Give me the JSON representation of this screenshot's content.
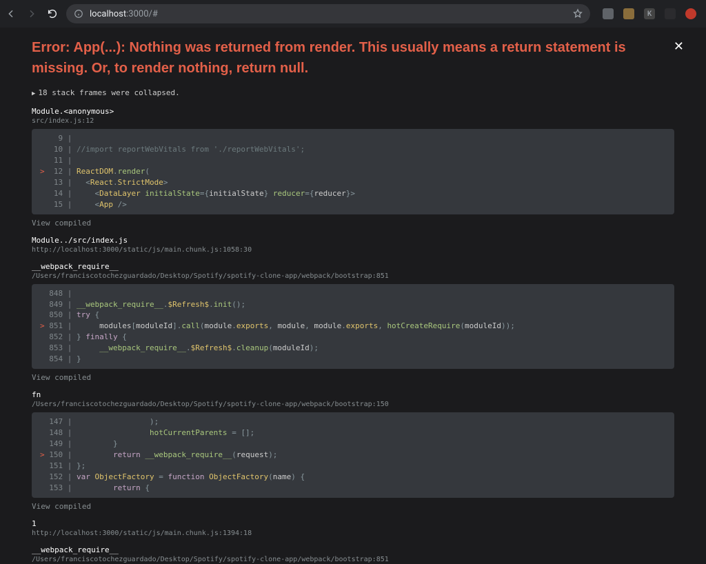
{
  "browser": {
    "url_host": "localhost",
    "url_rest": ":3000/#",
    "ext_k_letter": "K"
  },
  "error": {
    "title": "Error: App(...): Nothing was returned from render. This usually means a return statement is missing. Or, to render nothing, return null.",
    "collapsed_label": "18 stack frames were collapsed.",
    "close_glyph": "✕",
    "view_compiled": "View compiled"
  },
  "frames": [
    {
      "title": "Module.<anonymous>",
      "loc": "src/index.js:12",
      "lines": [
        {
          "n": "9",
          "hl": false,
          "tokens": []
        },
        {
          "n": "10",
          "hl": false,
          "tokens": [
            {
              "c": "tk-comment",
              "t": "//import reportWebVitals from './reportWebVitals';"
            }
          ]
        },
        {
          "n": "11",
          "hl": false,
          "tokens": []
        },
        {
          "n": "12",
          "hl": true,
          "tokens": [
            {
              "c": "tk-ident",
              "t": "ReactDOM"
            },
            {
              "c": "tk-punc",
              "t": "."
            },
            {
              "c": "tk-fn",
              "t": "render"
            },
            {
              "c": "tk-punc",
              "t": "("
            }
          ]
        },
        {
          "n": "13",
          "hl": false,
          "tokens": [
            {
              "c": "tk-plain",
              "t": "  "
            },
            {
              "c": "tk-punc",
              "t": "<"
            },
            {
              "c": "tk-ident",
              "t": "React"
            },
            {
              "c": "tk-punc",
              "t": "."
            },
            {
              "c": "tk-ident",
              "t": "StrictMode"
            },
            {
              "c": "tk-punc",
              "t": ">"
            }
          ]
        },
        {
          "n": "14",
          "hl": false,
          "tokens": [
            {
              "c": "tk-plain",
              "t": "    "
            },
            {
              "c": "tk-punc",
              "t": "<"
            },
            {
              "c": "tk-ident",
              "t": "DataLayer"
            },
            {
              "c": "tk-plain",
              "t": " "
            },
            {
              "c": "tk-fn",
              "t": "initialState"
            },
            {
              "c": "tk-punc",
              "t": "="
            },
            {
              "c": "tk-punc",
              "t": "{"
            },
            {
              "c": "tk-plain",
              "t": "initialState"
            },
            {
              "c": "tk-punc",
              "t": "}"
            },
            {
              "c": "tk-plain",
              "t": " "
            },
            {
              "c": "tk-fn",
              "t": "reducer"
            },
            {
              "c": "tk-punc",
              "t": "="
            },
            {
              "c": "tk-punc",
              "t": "{"
            },
            {
              "c": "tk-plain",
              "t": "reducer"
            },
            {
              "c": "tk-punc",
              "t": "}"
            },
            {
              "c": "tk-punc",
              "t": ">"
            }
          ]
        },
        {
          "n": "15",
          "hl": false,
          "tokens": [
            {
              "c": "tk-plain",
              "t": "    "
            },
            {
              "c": "tk-punc",
              "t": "<"
            },
            {
              "c": "tk-ident",
              "t": "App"
            },
            {
              "c": "tk-plain",
              "t": " "
            },
            {
              "c": "tk-punc",
              "t": "/>"
            }
          ]
        }
      ]
    },
    {
      "title": "Module../src/index.js",
      "loc": "http://localhost:3000/static/js/main.chunk.js:1058:30"
    },
    {
      "title": "__webpack_require__",
      "loc": "/Users/franciscotochezguardado/Desktop/Spotify/spotify-clone-app/webpack/bootstrap:851",
      "lines": [
        {
          "n": "848",
          "hl": false,
          "tokens": []
        },
        {
          "n": "849",
          "hl": false,
          "tokens": [
            {
              "c": "tk-fn",
              "t": "__webpack_require__"
            },
            {
              "c": "tk-punc",
              "t": "."
            },
            {
              "c": "tk-ident",
              "t": "$Refresh$"
            },
            {
              "c": "tk-punc",
              "t": "."
            },
            {
              "c": "tk-fn",
              "t": "init"
            },
            {
              "c": "tk-punc",
              "t": "();"
            }
          ]
        },
        {
          "n": "850",
          "hl": false,
          "tokens": [
            {
              "c": "tk-key",
              "t": "try"
            },
            {
              "c": "tk-plain",
              "t": " "
            },
            {
              "c": "tk-punc",
              "t": "{"
            }
          ]
        },
        {
          "n": "851",
          "hl": true,
          "tokens": [
            {
              "c": "tk-plain",
              "t": "     modules"
            },
            {
              "c": "tk-punc",
              "t": "["
            },
            {
              "c": "tk-plain",
              "t": "moduleId"
            },
            {
              "c": "tk-punc",
              "t": "]."
            },
            {
              "c": "tk-fn",
              "t": "call"
            },
            {
              "c": "tk-punc",
              "t": "("
            },
            {
              "c": "tk-plain",
              "t": "module"
            },
            {
              "c": "tk-punc",
              "t": "."
            },
            {
              "c": "tk-ident",
              "t": "exports"
            },
            {
              "c": "tk-punc",
              "t": ", "
            },
            {
              "c": "tk-plain",
              "t": "module"
            },
            {
              "c": "tk-punc",
              "t": ", "
            },
            {
              "c": "tk-plain",
              "t": "module"
            },
            {
              "c": "tk-punc",
              "t": "."
            },
            {
              "c": "tk-ident",
              "t": "exports"
            },
            {
              "c": "tk-punc",
              "t": ", "
            },
            {
              "c": "tk-fn",
              "t": "hotCreateRequire"
            },
            {
              "c": "tk-punc",
              "t": "("
            },
            {
              "c": "tk-plain",
              "t": "moduleId"
            },
            {
              "c": "tk-punc",
              "t": "));"
            }
          ]
        },
        {
          "n": "852",
          "hl": false,
          "tokens": [
            {
              "c": "tk-punc",
              "t": "}"
            },
            {
              "c": "tk-plain",
              "t": " "
            },
            {
              "c": "tk-key",
              "t": "finally"
            },
            {
              "c": "tk-plain",
              "t": " "
            },
            {
              "c": "tk-punc",
              "t": "{"
            }
          ]
        },
        {
          "n": "853",
          "hl": false,
          "tokens": [
            {
              "c": "tk-plain",
              "t": "     "
            },
            {
              "c": "tk-fn",
              "t": "__webpack_require__"
            },
            {
              "c": "tk-punc",
              "t": "."
            },
            {
              "c": "tk-ident",
              "t": "$Refresh$"
            },
            {
              "c": "tk-punc",
              "t": "."
            },
            {
              "c": "tk-fn",
              "t": "cleanup"
            },
            {
              "c": "tk-punc",
              "t": "("
            },
            {
              "c": "tk-plain",
              "t": "moduleId"
            },
            {
              "c": "tk-punc",
              "t": ");"
            }
          ]
        },
        {
          "n": "854",
          "hl": false,
          "tokens": [
            {
              "c": "tk-punc",
              "t": "}"
            }
          ]
        }
      ]
    },
    {
      "title": "fn",
      "loc": "/Users/franciscotochezguardado/Desktop/Spotify/spotify-clone-app/webpack/bootstrap:150",
      "lines": [
        {
          "n": "147",
          "hl": false,
          "tokens": [
            {
              "c": "tk-plain",
              "t": "                "
            },
            {
              "c": "tk-punc",
              "t": ");"
            }
          ]
        },
        {
          "n": "148",
          "hl": false,
          "tokens": [
            {
              "c": "tk-plain",
              "t": "                "
            },
            {
              "c": "tk-fn",
              "t": "hotCurrentParents"
            },
            {
              "c": "tk-plain",
              "t": " "
            },
            {
              "c": "tk-punc",
              "t": "="
            },
            {
              "c": "tk-plain",
              "t": " "
            },
            {
              "c": "tk-punc",
              "t": "[];"
            }
          ]
        },
        {
          "n": "149",
          "hl": false,
          "tokens": [
            {
              "c": "tk-plain",
              "t": "        "
            },
            {
              "c": "tk-punc",
              "t": "}"
            }
          ]
        },
        {
          "n": "150",
          "hl": true,
          "tokens": [
            {
              "c": "tk-plain",
              "t": "        "
            },
            {
              "c": "tk-key",
              "t": "return"
            },
            {
              "c": "tk-plain",
              "t": " "
            },
            {
              "c": "tk-fn",
              "t": "__webpack_require__"
            },
            {
              "c": "tk-punc",
              "t": "("
            },
            {
              "c": "tk-plain",
              "t": "request"
            },
            {
              "c": "tk-punc",
              "t": ");"
            }
          ]
        },
        {
          "n": "151",
          "hl": false,
          "tokens": [
            {
              "c": "tk-punc",
              "t": "};"
            }
          ]
        },
        {
          "n": "152",
          "hl": false,
          "tokens": [
            {
              "c": "tk-key",
              "t": "var"
            },
            {
              "c": "tk-plain",
              "t": " "
            },
            {
              "c": "tk-ident",
              "t": "ObjectFactory"
            },
            {
              "c": "tk-plain",
              "t": " "
            },
            {
              "c": "tk-punc",
              "t": "="
            },
            {
              "c": "tk-plain",
              "t": " "
            },
            {
              "c": "tk-key",
              "t": "function"
            },
            {
              "c": "tk-plain",
              "t": " "
            },
            {
              "c": "tk-ident",
              "t": "ObjectFactory"
            },
            {
              "c": "tk-punc",
              "t": "("
            },
            {
              "c": "tk-plain",
              "t": "name"
            },
            {
              "c": "tk-punc",
              "t": ")"
            },
            {
              "c": "tk-plain",
              "t": " "
            },
            {
              "c": "tk-punc",
              "t": "{"
            }
          ]
        },
        {
          "n": "153",
          "hl": false,
          "tokens": [
            {
              "c": "tk-plain",
              "t": "        "
            },
            {
              "c": "tk-key",
              "t": "return"
            },
            {
              "c": "tk-plain",
              "t": " "
            },
            {
              "c": "tk-punc",
              "t": "{"
            }
          ]
        }
      ]
    },
    {
      "title": "1",
      "loc": "http://localhost:3000/static/js/main.chunk.js:1394:18"
    },
    {
      "title": "__webpack_require__",
      "loc": "/Users/franciscotochezguardado/Desktop/Spotify/spotify-clone-app/webpack/bootstrap:851"
    }
  ]
}
